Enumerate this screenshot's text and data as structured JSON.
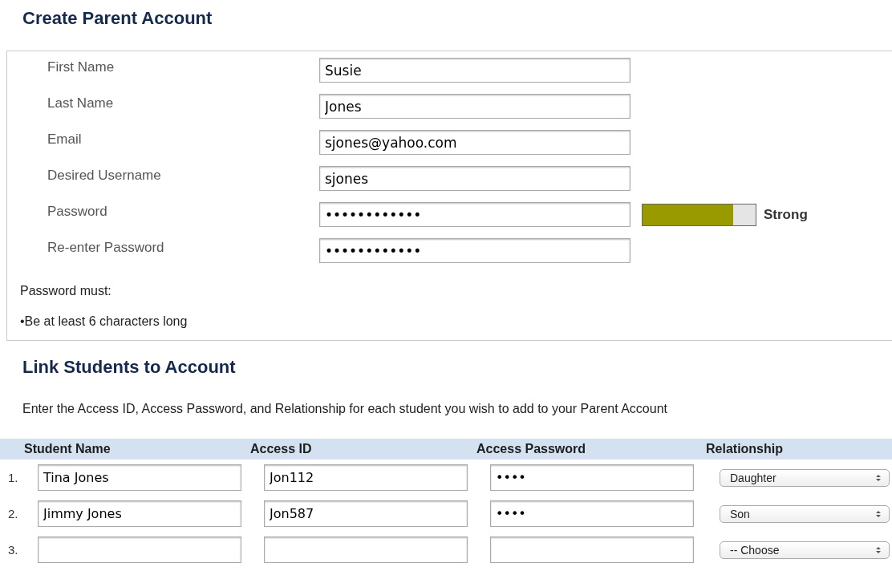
{
  "account": {
    "title": "Create Parent Account",
    "fields": [
      {
        "label": "First Name",
        "value": "Susie"
      },
      {
        "label": "Last Name",
        "value": "Jones"
      },
      {
        "label": "Email",
        "value": "sjones@yahoo.com"
      },
      {
        "label": "Desired Username",
        "value": "sjones"
      },
      {
        "label": "Password",
        "value": "••••••••••••",
        "strength": {
          "level": 0.8,
          "reading": "Strong"
        }
      },
      {
        "label": "Re-enter Password",
        "value": "••••••••••••"
      }
    ],
    "rules_title": "Password must:",
    "rules": [
      "•Be at least 6 characters long"
    ]
  },
  "students": {
    "title": "Link Students to Account",
    "instructions": "Enter the Access ID, Access Password, and Relationship for each student you wish to add to your Parent Account",
    "columns": [
      "Student Name",
      "Access ID",
      "Access Password",
      "Relationship"
    ],
    "rows": [
      {
        "number": "1.",
        "student_name": "Tina Jones",
        "access_id": "Jon112",
        "access_password": "••••",
        "relationship": "Daughter"
      },
      {
        "number": "2.",
        "student_name": "Jimmy Jones",
        "access_id": "Jon587",
        "access_password": "••••",
        "relationship": "Son"
      },
      {
        "number": "3.",
        "student_name": "",
        "access_id": "",
        "access_password": "",
        "relationship": "-- Choose"
      }
    ]
  }
}
